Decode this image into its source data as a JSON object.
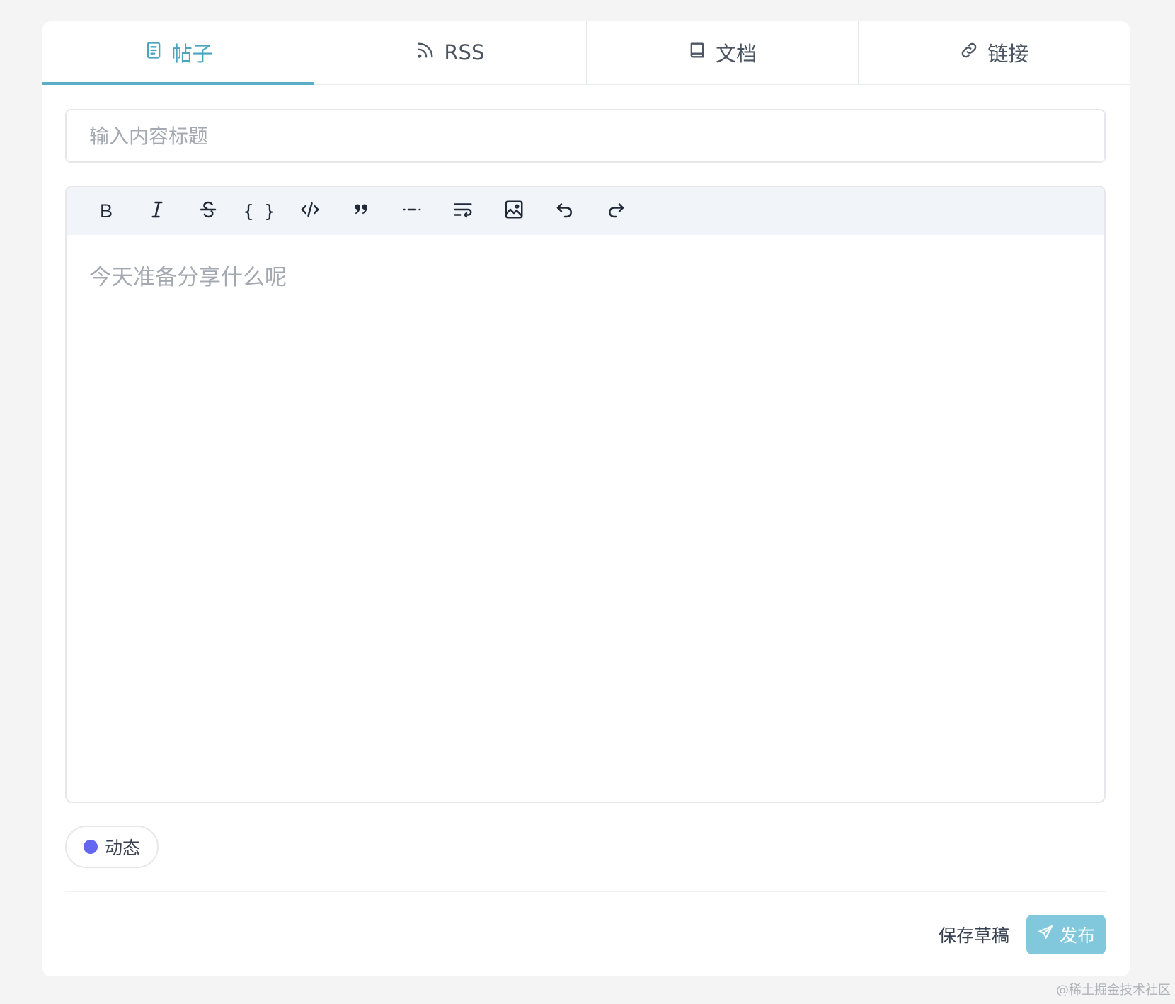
{
  "tabs": [
    {
      "label": "帖子",
      "icon": "document-icon",
      "active": true
    },
    {
      "label": "RSS",
      "icon": "rss-icon",
      "active": false
    },
    {
      "label": "文档",
      "icon": "book-icon",
      "active": false
    },
    {
      "label": "链接",
      "icon": "link-icon",
      "active": false
    }
  ],
  "title_input": {
    "placeholder": "输入内容标题",
    "value": ""
  },
  "toolbar": {
    "tools": [
      "bold-icon",
      "italic-icon",
      "strikethrough-icon",
      "code-block-icon",
      "inline-code-icon",
      "quote-icon",
      "horizontal-rule-icon",
      "text-wrap-icon",
      "image-icon",
      "undo-icon",
      "redo-icon"
    ],
    "bold_glyph": "B",
    "code_block_glyph": "{ }"
  },
  "editor": {
    "placeholder": "今天准备分享什么呢"
  },
  "topic_chip": {
    "label": "动态",
    "dot_color": "#6366f1"
  },
  "actions": {
    "save_draft_label": "保存草稿",
    "publish_label": "发布"
  },
  "colors": {
    "accent": "#4aa3bf",
    "publish_button": "#82c8dc"
  },
  "watermark": "@稀土掘金技术社区"
}
